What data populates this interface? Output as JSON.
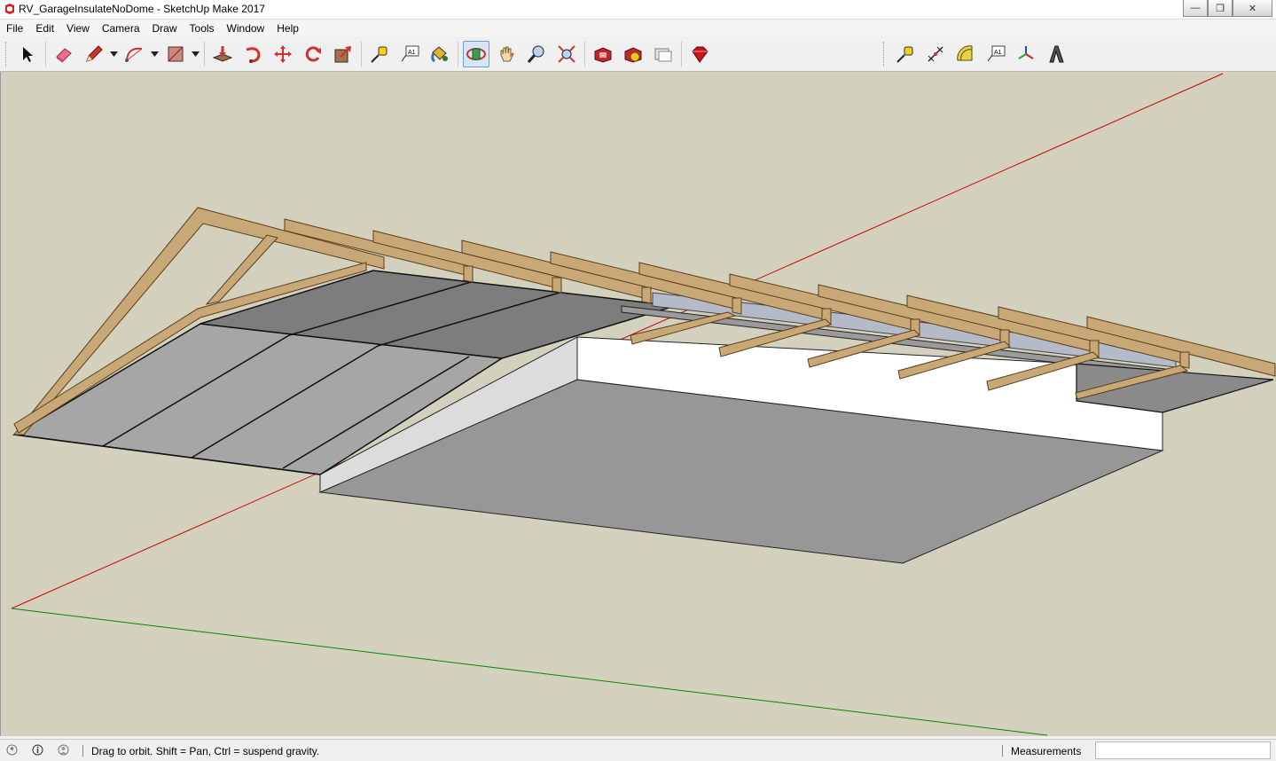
{
  "window": {
    "title": "RV_GarageInsulateNoDome - SketchUp Make 2017",
    "minimize_glyph": "—",
    "maximize_glyph": "❐",
    "close_glyph": "✕"
  },
  "menu": [
    "File",
    "Edit",
    "View",
    "Camera",
    "Draw",
    "Tools",
    "Window",
    "Help"
  ],
  "toolbar_icons": {
    "main": [
      "select-arrow-icon",
      "eraser-icon",
      "pencil-icon",
      "arc-icon",
      "rectangle-icon",
      "push-pull-icon",
      "follow-me-icon",
      "move-icon",
      "rotate-icon",
      "scale-icon",
      "tape-measure-icon",
      "text-icon",
      "paint-bucket-icon",
      "orbit-icon",
      "pan-icon",
      "zoom-icon",
      "zoom-extents-icon",
      "warehouse-icon",
      "extension-warehouse-icon",
      "layout-icon",
      "ruby-icon"
    ],
    "construction": [
      "tape-measure-icon",
      "dimension-icon",
      "protractor-icon",
      "text-icon",
      "axes-icon",
      "3d-text-icon"
    ],
    "active_tool": "orbit-icon",
    "text_icon_label": "A1"
  },
  "status": {
    "hint": "Drag to orbit. Shift = Pan, Ctrl = suspend gravity.",
    "measurements_label": "Measurements",
    "measurements_value": ""
  },
  "colors": {
    "viewport_bg": "#d3d1bd",
    "wood": "#c9a878",
    "roof_dark": "#7b7b7b",
    "roof_light": "#a4a4a4",
    "floor": "#979797",
    "wall": "#ffffff",
    "red_axis": "#cc0000",
    "green_axis": "#008800"
  }
}
